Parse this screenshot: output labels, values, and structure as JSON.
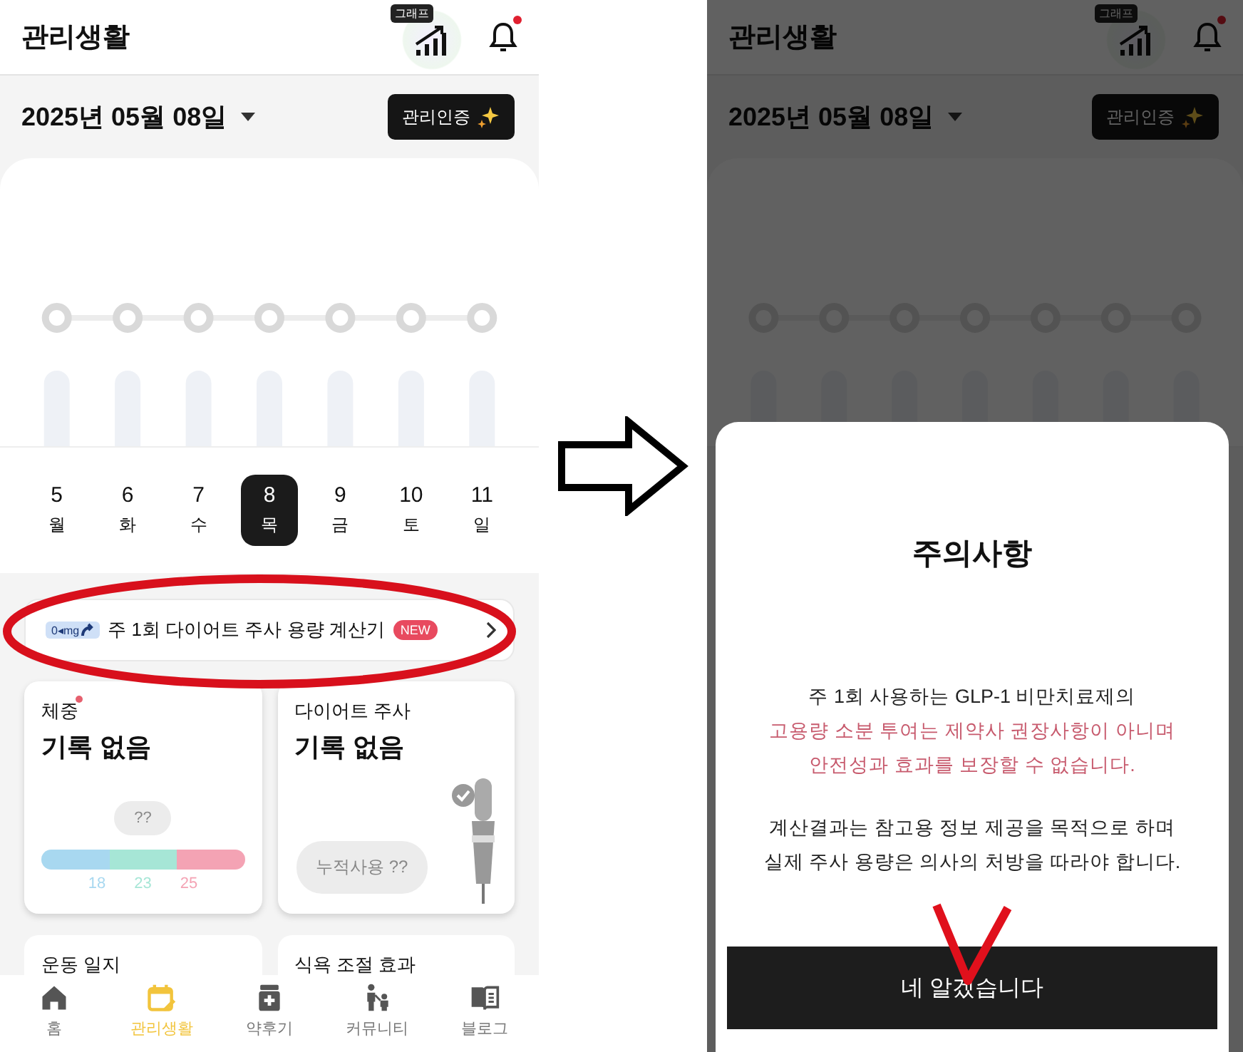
{
  "left_screen": {
    "header": {
      "title": "관리생활",
      "graph_badge": "그래프",
      "unread": true
    },
    "date": "2025년 05월 08일",
    "certify_button": "관리인증",
    "days": [
      {
        "date": "5",
        "weekday": "월",
        "selected": false
      },
      {
        "date": "6",
        "weekday": "화",
        "selected": false
      },
      {
        "date": "7",
        "weekday": "수",
        "selected": false
      },
      {
        "date": "8",
        "weekday": "목",
        "selected": true
      },
      {
        "date": "9",
        "weekday": "금",
        "selected": false
      },
      {
        "date": "10",
        "weekday": "토",
        "selected": false
      },
      {
        "date": "11",
        "weekday": "일",
        "selected": false
      }
    ],
    "calculator_banner": {
      "icon_label": "0◂mg",
      "label": "주 1회 다이어트 주사 용량 계산기",
      "badge": "NEW"
    },
    "cards": [
      {
        "kind": "weight",
        "title": "체중",
        "new_dot": true,
        "value": "기록 없음",
        "pill": "??",
        "scale": [
          {
            "label": "18",
            "color": "#a8d8f0"
          },
          {
            "label": "23",
            "color": "#a6e6d6"
          },
          {
            "label": "25",
            "color": "#f4a3b4"
          }
        ]
      },
      {
        "kind": "injection",
        "title": "다이어트 주사",
        "new_dot": false,
        "value": "기록 없음",
        "pill": "누적사용 ??"
      }
    ],
    "partial_cards": [
      "운동 일지",
      "식욕 조절 효과"
    ],
    "nav": [
      {
        "kind": "home",
        "label": "홈",
        "selected": false
      },
      {
        "kind": "calendar",
        "label": "관리생활",
        "selected": true
      },
      {
        "kind": "medicine",
        "label": "약후기",
        "selected": false
      },
      {
        "kind": "people",
        "label": "커뮤니티",
        "selected": false
      },
      {
        "kind": "book",
        "label": "블로그",
        "selected": false
      }
    ]
  },
  "right_screen": {
    "header": {
      "title": "관리생활",
      "graph_badge": "그래프",
      "unread": true
    },
    "date": "2025년 05월 08일",
    "certify_button": "관리인증",
    "modal": {
      "title": "주의사항",
      "paragraphs": [
        {
          "lines": [
            {
              "kind": "normal",
              "text": "주 1회 사용하는 GLP-1 비만치료제의"
            },
            {
              "kind": "warning",
              "text": "고용량 소분 투여는 제약사 권장사항이 아니며"
            },
            {
              "kind": "warning",
              "text": "안전성과 효과를 보장할 수 없습니다."
            }
          ]
        },
        {
          "lines": [
            {
              "kind": "normal",
              "text": "계산결과는 참고용 정보 제공을 목적으로 하며"
            },
            {
              "kind": "normal",
              "text": "실제 주사 용량은 의사의 처방을 따라야 합니다."
            }
          ]
        }
      ],
      "confirm_button": "네 알겠습니다"
    }
  }
}
